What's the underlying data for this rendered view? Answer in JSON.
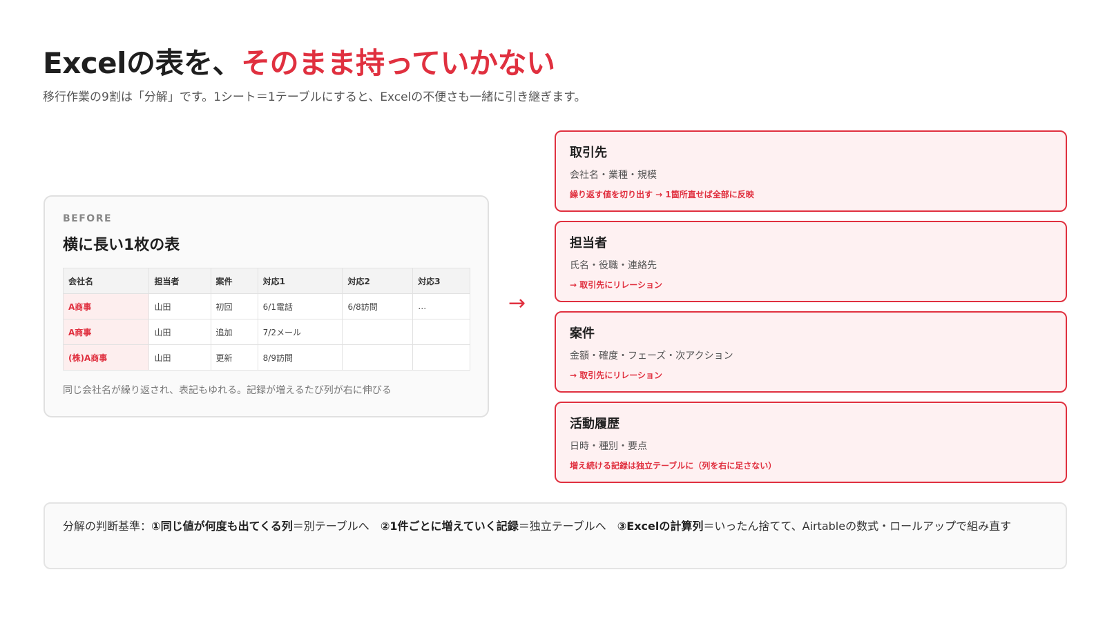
{
  "header": {
    "title_main": "Excelの表を、",
    "title_accent": "そのまま持っていかない",
    "subtitle": "移行作業の9割は「分解」です。1シート＝1テーブルにすると、Excelの不便さも一緒に引き継ぎます。"
  },
  "before": {
    "label": "BEFORE",
    "title": "横に長い1枚の表",
    "columns": [
      "会社名",
      "担当者",
      "案件",
      "対応1",
      "対応2",
      "対応3"
    ],
    "rows": [
      [
        "A商事",
        "山田",
        "初回",
        "6/1電話",
        "6/8訪問",
        "…"
      ],
      [
        "A商事",
        "山田",
        "追加",
        "7/2メール",
        "",
        ""
      ],
      [
        "(株)A商事",
        "山田",
        "更新",
        "8/9訪問",
        "",
        ""
      ]
    ],
    "note": "同じ会社名が繰り返され、表記もゆれる。記録が増えるたび列が右に伸びる"
  },
  "arrow": "→",
  "tables": [
    {
      "title": "取引先",
      "fields": "会社名・業種・規模",
      "note": "繰り返す値を切り出す → 1箇所直せば全部に反映"
    },
    {
      "title": "担当者",
      "fields": "氏名・役職・連絡先",
      "note": "→ 取引先にリレーション"
    },
    {
      "title": "案件",
      "fields": "金額・確度・フェーズ・次アクション",
      "note": "→ 取引先にリレーション"
    },
    {
      "title": "活動履歴",
      "fields": "日時・種別・要点",
      "note": "増え続ける記録は独立テーブルに（列を右に足さない）"
    }
  ],
  "criteria": {
    "prefix": "分解の判断基準：",
    "c1_bold": "①同じ値が何度も出てくる列",
    "c1_rest": "＝別テーブルへ　",
    "c2_bold": "②1件ごとに増えていく記録",
    "c2_rest": "＝独立テーブルへ　",
    "c3_bold": "③Excelの計算列",
    "c3_rest": "＝いったん捨てて、Airtableの数式・ロールアップで組み直す"
  },
  "colors": {
    "accent": "#e0303f",
    "card_bg": "#fef1f2",
    "panel_bg": "#fafafa"
  }
}
